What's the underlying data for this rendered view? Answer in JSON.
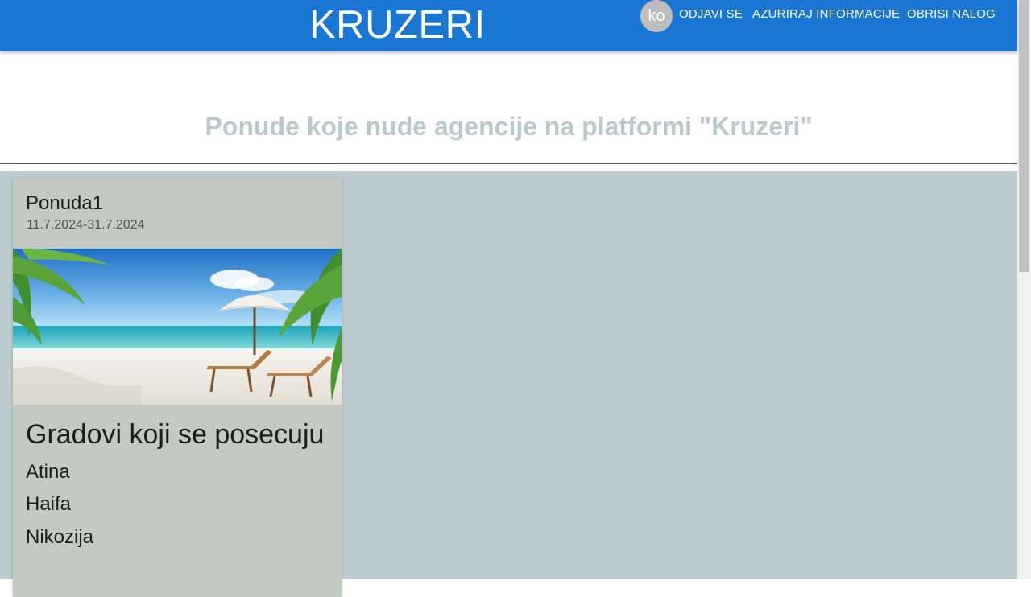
{
  "header": {
    "brand": "KRUZERI",
    "avatar_initials": "ko",
    "nav": {
      "logout": "ODJAVI SE",
      "update_info": "AZURIRAJ INFORMACIJE",
      "delete_account": "OBRISI NALOG"
    }
  },
  "hero": {
    "title": "Ponude koje nude agencije na platformi \"Kruzeri\""
  },
  "offer": {
    "title": "Ponuda1",
    "dates": "11.7.2024-31.7.2024",
    "cities_heading": "Gradovi koji se posecuju",
    "cities": [
      "Atina",
      "Haifa",
      "Nikozija"
    ]
  },
  "colors": {
    "appbar": "#1976d2",
    "content_bg": "#bccbcf",
    "card_bg": "#c4c9c4",
    "hero_title": "#b9c9cd"
  },
  "icons": {
    "avatar": "avatar-circle",
    "card_image": "beach-umbrella-loungers-image"
  }
}
